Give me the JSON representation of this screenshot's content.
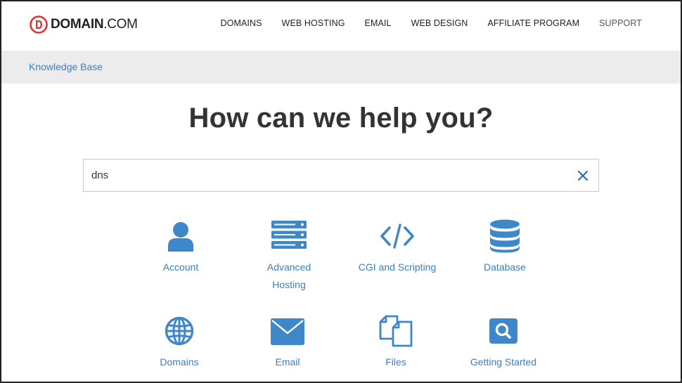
{
  "brand": {
    "name_bold": "DOMAIN",
    "name_suffix": ".COM",
    "logo_letter": "D"
  },
  "nav": {
    "items": [
      "DOMAINS",
      "WEB HOSTING",
      "EMAIL",
      "WEB DESIGN",
      "AFFILIATE PROGRAM",
      "SUPPORT"
    ]
  },
  "breadcrumb": {
    "label": "Knowledge Base"
  },
  "hero": {
    "title": "How can we help you?"
  },
  "search": {
    "value": "dns",
    "placeholder": ""
  },
  "categories": [
    {
      "label": "Account",
      "icon": "user-icon"
    },
    {
      "label": "Advanced Hosting",
      "line1": "Advanced",
      "line2": "Hosting",
      "icon": "server-icon"
    },
    {
      "label": "CGI and Scripting",
      "icon": "code-icon"
    },
    {
      "label": "Database",
      "icon": "database-icon"
    },
    {
      "label": "Domains",
      "icon": "globe-icon"
    },
    {
      "label": "Email",
      "icon": "envelope-icon"
    },
    {
      "label": "Files",
      "icon": "files-icon"
    },
    {
      "label": "Getting Started",
      "icon": "search-icon"
    }
  ],
  "colors": {
    "accent": "#3b7ec0",
    "icon": "#3e87c8",
    "logo_red": "#e0322f",
    "crumb_bg": "#ececec"
  }
}
